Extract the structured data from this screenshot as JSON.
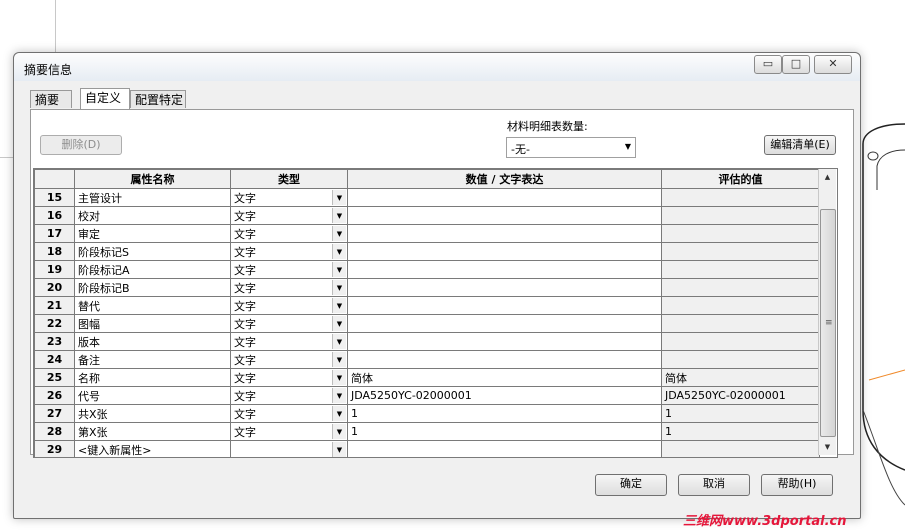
{
  "dialog": {
    "title": "摘要信息",
    "window_buttons": {
      "minimize": "▭",
      "restore": "□",
      "close": "✕"
    }
  },
  "tabs": [
    {
      "label": "摘要",
      "active": false
    },
    {
      "label": "自定义",
      "active": true
    },
    {
      "label": "配置特定",
      "active": false
    }
  ],
  "toolbar": {
    "delete_label": "删除(D)",
    "bom_qty_label": "材料明细表数量:",
    "bom_qty_value": "-无-",
    "edit_list_label": "编辑清单(E)"
  },
  "table": {
    "headers": [
      "",
      "属性名称",
      "类型",
      "数值 / 文字表达",
      "评估的值"
    ],
    "rows": [
      {
        "num": "15",
        "name": "主管设计",
        "type": "文字",
        "value": "",
        "evaluated": ""
      },
      {
        "num": "16",
        "name": "校对",
        "type": "文字",
        "value": "",
        "evaluated": ""
      },
      {
        "num": "17",
        "name": "审定",
        "type": "文字",
        "value": "",
        "evaluated": ""
      },
      {
        "num": "18",
        "name": "阶段标记S",
        "type": "文字",
        "value": "",
        "evaluated": ""
      },
      {
        "num": "19",
        "name": "阶段标记A",
        "type": "文字",
        "value": "",
        "evaluated": ""
      },
      {
        "num": "20",
        "name": "阶段标记B",
        "type": "文字",
        "value": "",
        "evaluated": ""
      },
      {
        "num": "21",
        "name": "替代",
        "type": "文字",
        "value": "",
        "evaluated": ""
      },
      {
        "num": "22",
        "name": "图幅",
        "type": "文字",
        "value": "",
        "evaluated": ""
      },
      {
        "num": "23",
        "name": "版本",
        "type": "文字",
        "value": "",
        "evaluated": ""
      },
      {
        "num": "24",
        "name": "备注",
        "type": "文字",
        "value": "",
        "evaluated": ""
      },
      {
        "num": "25",
        "name": "名称",
        "type": "文字",
        "value": "简体",
        "evaluated": "简体"
      },
      {
        "num": "26",
        "name": "代号",
        "type": "文字",
        "value": "JDA5250YC-02000001",
        "evaluated": "JDA5250YC-02000001"
      },
      {
        "num": "27",
        "name": "共X张",
        "type": "文字",
        "value": "1",
        "evaluated": "1"
      },
      {
        "num": "28",
        "name": "第X张",
        "type": "文字",
        "value": "1",
        "evaluated": "1"
      },
      {
        "num": "29",
        "name": "<键入新属性>",
        "type": "",
        "value": "",
        "evaluated": ""
      }
    ]
  },
  "footer": {
    "ok_label": "确定",
    "cancel_label": "取消",
    "help_label": "帮助(H)"
  },
  "watermark": "三维网www.3dportal.cn",
  "colors": {
    "watermark": "#e5163a",
    "dialog_bg": "#f0f0f0",
    "header_bg": "#f0f0f0"
  }
}
